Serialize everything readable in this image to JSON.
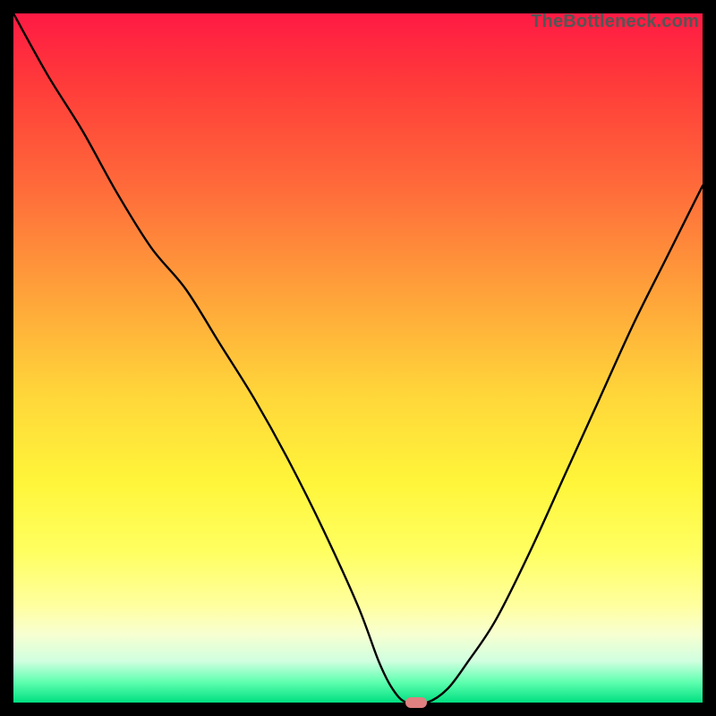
{
  "watermark_text": "TheBottleneck.com",
  "colors": {
    "frame": "#000000",
    "top_gradient": "#ff1a44",
    "mid_gradient": "#ffd53a",
    "bottom_gradient": "#00e080",
    "curve": "#000000",
    "marker": "#e08080"
  },
  "chart_data": {
    "type": "line",
    "title": "",
    "xlabel": "",
    "ylabel": "",
    "xlim": [
      0,
      100
    ],
    "ylim": [
      0,
      100
    ],
    "x": [
      0,
      5,
      10,
      15,
      20,
      25,
      30,
      35,
      40,
      45,
      50,
      53,
      55,
      57,
      60,
      63,
      66,
      70,
      75,
      80,
      85,
      90,
      95,
      100
    ],
    "values": [
      100,
      91,
      83,
      74,
      66,
      60,
      52,
      44,
      35,
      25,
      14,
      6,
      2,
      0,
      0,
      2,
      6,
      12,
      22,
      33,
      44,
      55,
      65,
      75
    ],
    "flat_bottom_range": [
      55,
      62
    ],
    "marker": {
      "x": 58.5,
      "y": 0
    },
    "notes": "y axis inverted visually (0 at bottom); values are approximate percentage heights read from curve"
  }
}
